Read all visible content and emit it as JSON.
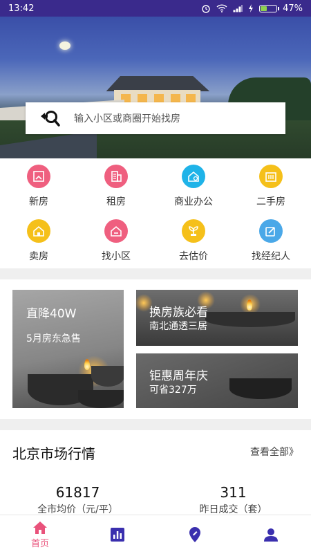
{
  "status_bar": {
    "time": "13:42",
    "battery": "47%",
    "battery_level": 0.47
  },
  "search": {
    "placeholder": "输入小区或商圈开始找房",
    "icon": "search-icon"
  },
  "categories": [
    {
      "label": "新房",
      "icon": "new-house-icon",
      "color": "#ef5f7f"
    },
    {
      "label": "租房",
      "icon": "rent-building-icon",
      "color": "#ef5f7f"
    },
    {
      "label": "商业办公",
      "icon": "office-icon",
      "color": "#1fb3e8"
    },
    {
      "label": "二手房",
      "icon": "second-hand-house-icon",
      "color": "#f5c01a"
    },
    {
      "label": "卖房",
      "icon": "sell-house-icon",
      "color": "#f5c01a"
    },
    {
      "label": "找小区",
      "icon": "community-icon",
      "color": "#ef5f7f"
    },
    {
      "label": "去估价",
      "icon": "valuation-icon",
      "color": "#f5c01a"
    },
    {
      "label": "找经纪人",
      "icon": "agent-icon",
      "color": "#4aa8e8"
    }
  ],
  "promos": [
    {
      "title": "直降40W",
      "subtitle": "5月房东急售"
    },
    {
      "title": "换房族必看",
      "subtitle": "南北通透三居"
    },
    {
      "title": "钜惠周年庆",
      "subtitle": "可省327万"
    }
  ],
  "market": {
    "title": "北京市场行情",
    "view_all": "查看全部》",
    "stats": [
      {
        "value": "61817",
        "label": "全市均价（元/平）"
      },
      {
        "value": "311",
        "label": "昨日成交（套）"
      }
    ]
  },
  "bottom_nav": {
    "home_label": "首页",
    "accent": "#e9527b",
    "icon_color": "#3a2fae"
  }
}
